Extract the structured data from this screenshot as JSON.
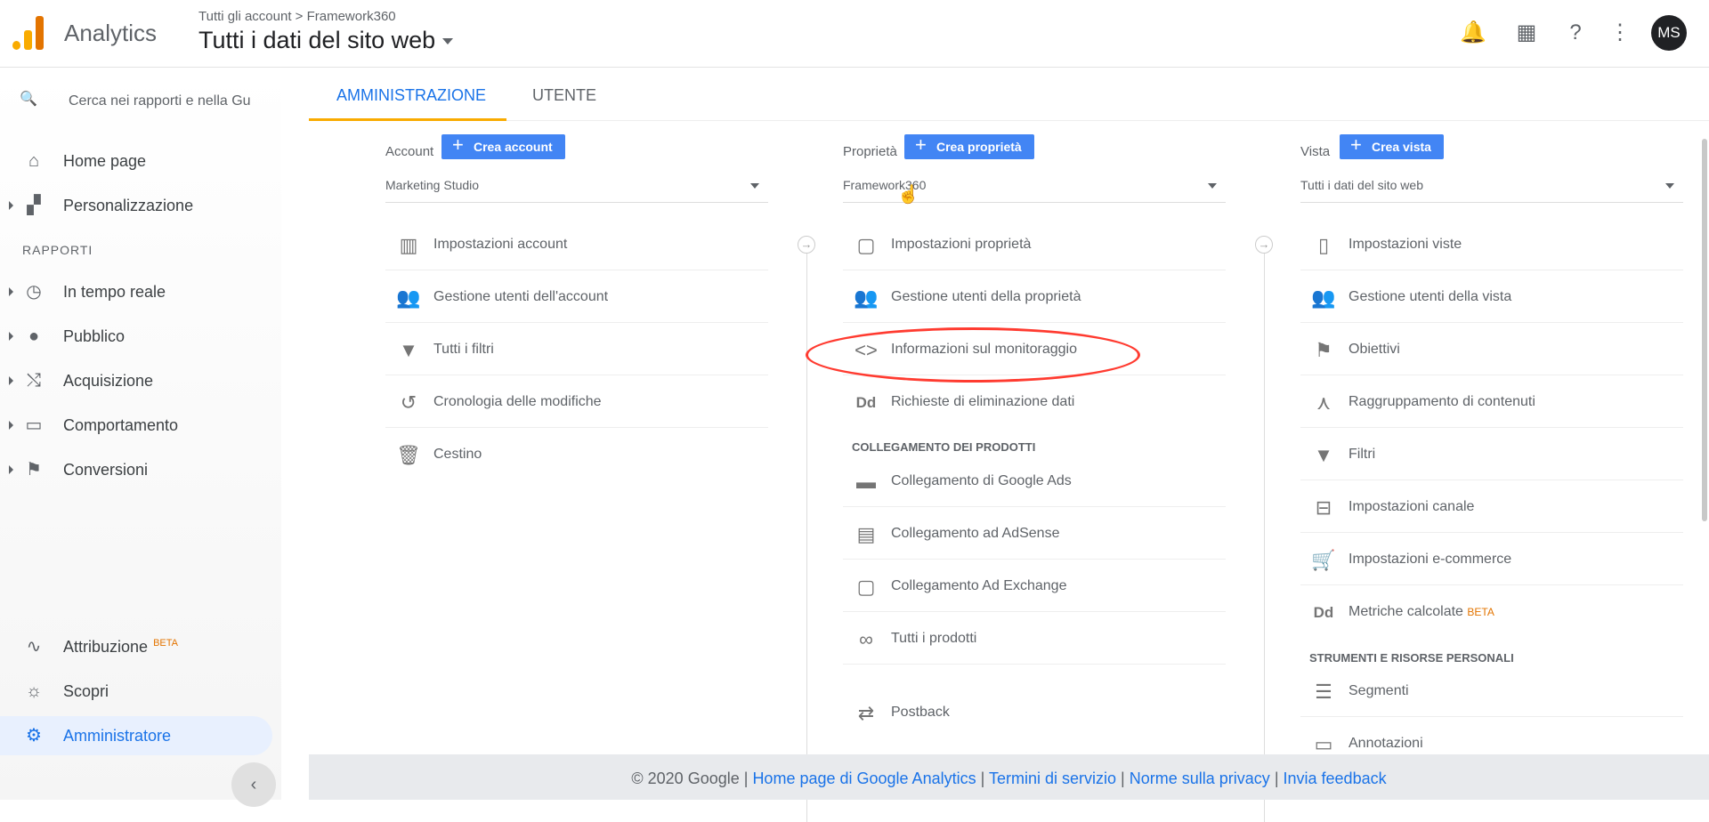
{
  "topbar": {
    "app_name": "Analytics",
    "breadcrumb": "Tutti gli account > Framework360",
    "property_title": "Tutti i dati del sito web",
    "avatar": "MS"
  },
  "sidebar": {
    "search_placeholder": "Cerca nei rapporti e nella Gu",
    "items_top": [
      {
        "label": "Home page"
      },
      {
        "label": "Personalizzazione"
      }
    ],
    "section": "RAPPORTI",
    "items_reports": [
      {
        "label": "In tempo reale"
      },
      {
        "label": "Pubblico"
      },
      {
        "label": "Acquisizione"
      },
      {
        "label": "Comportamento"
      },
      {
        "label": "Conversioni"
      }
    ],
    "items_bottom": [
      {
        "label": "Attribuzione",
        "badge": "BETA"
      },
      {
        "label": "Scopri"
      },
      {
        "label": "Amministratore"
      }
    ]
  },
  "tabs": [
    "AMMINISTRAZIONE",
    "UTENTE"
  ],
  "account": {
    "label": "Account",
    "button": "Crea account",
    "select": "Marketing Studio",
    "items": [
      "Impostazioni account",
      "Gestione utenti dell'account",
      "Tutti i filtri",
      "Cronologia delle modifiche",
      "Cestino"
    ]
  },
  "property": {
    "label": "Proprietà",
    "button": "Crea proprietà",
    "select": "Framework360",
    "items": [
      "Impostazioni proprietà",
      "Gestione utenti della proprietà",
      "Informazioni sul monitoraggio",
      "Richieste di eliminazione dati"
    ],
    "products_head": "COLLEGAMENTO DEI PRODOTTI",
    "products": [
      "Collegamento di Google Ads",
      "Collegamento ad AdSense",
      "Collegamento Ad Exchange",
      "Tutti i prodotti",
      "Postback"
    ]
  },
  "view": {
    "label": "Vista",
    "button": "Crea vista",
    "select": "Tutti i dati del sito web",
    "items": [
      "Impostazioni viste",
      "Gestione utenti della vista",
      "Obiettivi",
      "Raggruppamento di contenuti",
      "Filtri",
      "Impostazioni canale",
      "Impostazioni e-commerce",
      "Metriche calcolate"
    ],
    "beta": "BETA",
    "tools_head": "STRUMENTI E RISORSE PERSONALI",
    "tools": [
      "Segmenti",
      "Annotazioni"
    ]
  },
  "footer": {
    "copyright": "© 2020 Google |",
    "link1": "Home page di Google Analytics",
    "link2": "Termini di servizio",
    "link3": "Norme sulla privacy",
    "link4": "Invia feedback",
    "sep": "|"
  },
  "icons": {
    "accent": "#1a73e8",
    "logo": "#f9ab00",
    "highlight": "#ff3b30"
  }
}
